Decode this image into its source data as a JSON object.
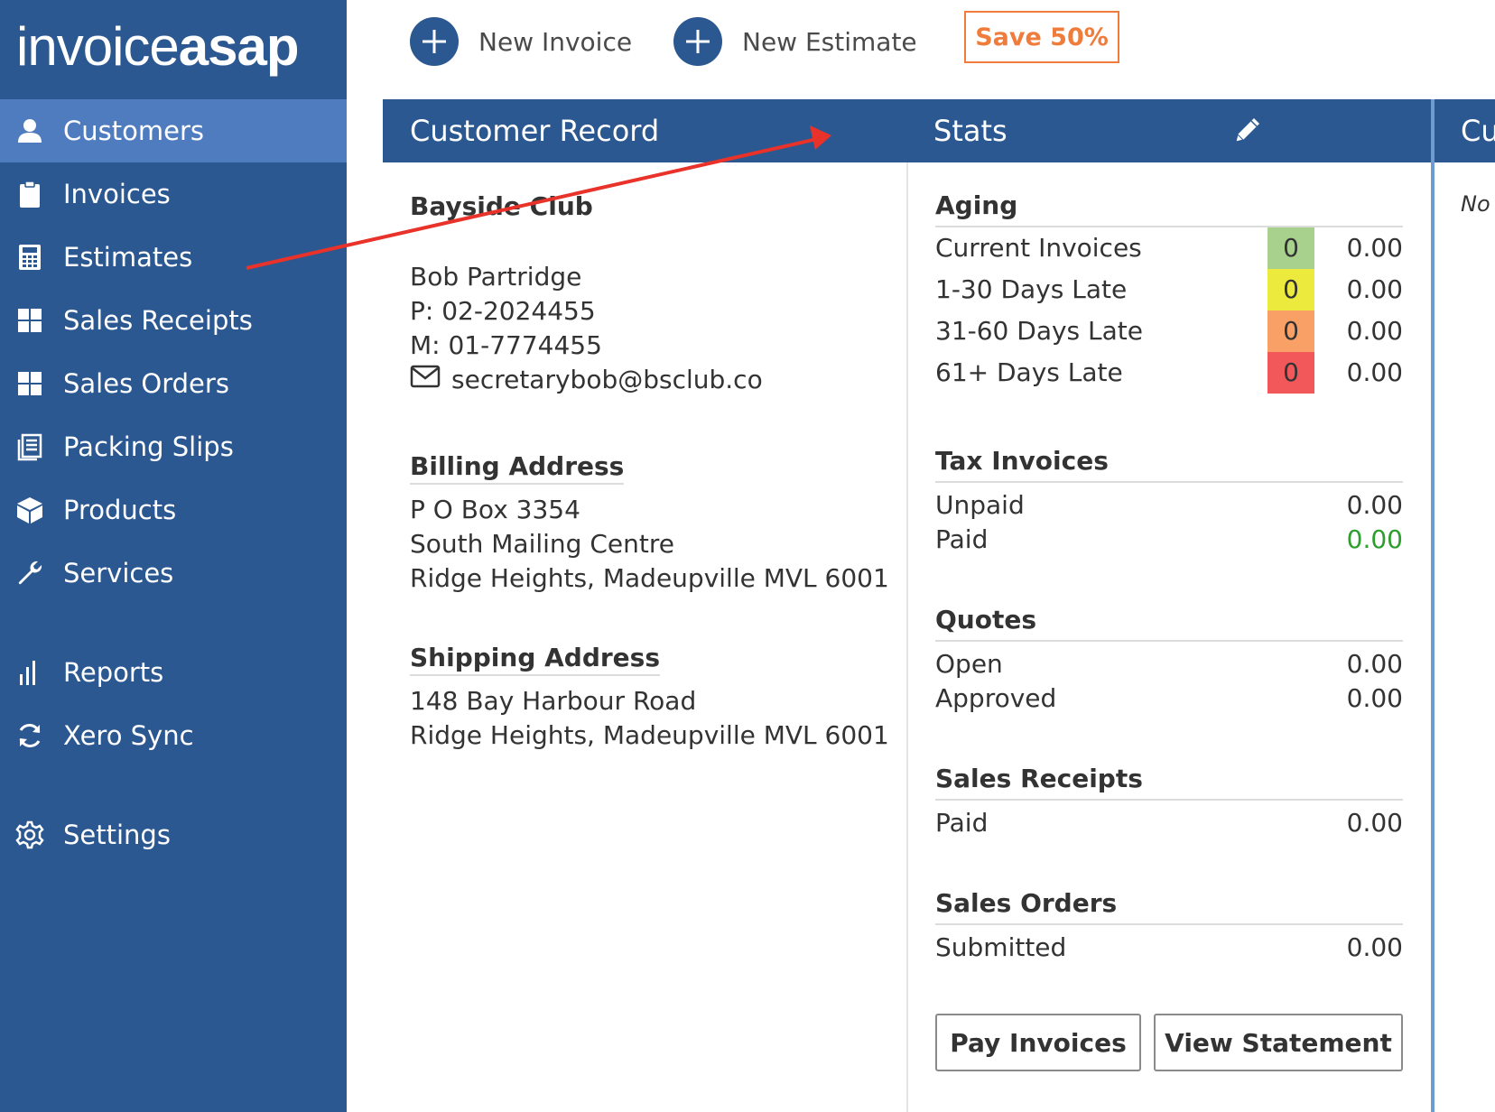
{
  "app": {
    "logo_light": "invoice",
    "logo_bold": "asap"
  },
  "sidebar": {
    "items": [
      {
        "label": "Customers",
        "icon": "user-icon"
      },
      {
        "label": "Invoices",
        "icon": "clipboard-icon"
      },
      {
        "label": "Estimates",
        "icon": "calculator-icon"
      },
      {
        "label": "Sales Receipts",
        "icon": "grid-icon"
      },
      {
        "label": "Sales Orders",
        "icon": "grid-icon"
      },
      {
        "label": "Packing Slips",
        "icon": "packing-icon"
      },
      {
        "label": "Products",
        "icon": "box-icon"
      },
      {
        "label": "Services",
        "icon": "wrench-icon"
      },
      {
        "label": "Reports",
        "icon": "bar-chart-icon"
      },
      {
        "label": "Xero Sync",
        "icon": "sync-icon"
      },
      {
        "label": "Settings",
        "icon": "gear-icon"
      }
    ]
  },
  "toolbar": {
    "new_invoice": "New Invoice",
    "new_estimate": "New Estimate",
    "promo": "Save 50%"
  },
  "panels": {
    "customer_record": "Customer Record",
    "stats": "Stats",
    "third_partial": "Cu",
    "third_partial_body": "No"
  },
  "customer": {
    "name": "Bayside Club",
    "contact": "Bob Partridge",
    "phone": "P: 02-2024455",
    "mobile": "M: 01-7774455",
    "email": "secretarybob@bsclub.co",
    "billing_heading": "Billing Address",
    "billing": [
      "P O Box 3354",
      "South Mailing Centre",
      "Ridge Heights, Madeupville MVL 6001"
    ],
    "shipping_heading": "Shipping Address",
    "shipping": [
      "148 Bay Harbour Road",
      "Ridge Heights, Madeupville MVL 6001"
    ]
  },
  "stats": {
    "aging": {
      "heading": "Aging",
      "rows": [
        {
          "label": "Current Invoices",
          "count": "0",
          "value": "0.00",
          "color": "#a9d18e"
        },
        {
          "label": "1-30 Days Late",
          "count": "0",
          "value": "0.00",
          "color": "#ecea3c"
        },
        {
          "label": "31-60 Days Late",
          "count": "0",
          "value": "0.00",
          "color": "#f9a066"
        },
        {
          "label": "61+ Days Late",
          "count": "0",
          "value": "0.00",
          "color": "#f2575a"
        }
      ]
    },
    "tax_invoices": {
      "heading": "Tax Invoices",
      "rows": [
        {
          "label": "Unpaid",
          "value": "0.00"
        },
        {
          "label": "Paid",
          "value": "0.00"
        }
      ]
    },
    "quotes": {
      "heading": "Quotes",
      "rows": [
        {
          "label": "Open",
          "value": "0.00"
        },
        {
          "label": "Approved",
          "value": "0.00"
        }
      ]
    },
    "sales_receipts": {
      "heading": "Sales Receipts",
      "rows": [
        {
          "label": "Paid",
          "value": "0.00"
        }
      ]
    },
    "sales_orders": {
      "heading": "Sales Orders",
      "rows": [
        {
          "label": "Submitted",
          "value": "0.00"
        }
      ]
    }
  },
  "buttons": {
    "pay_invoices": "Pay Invoices",
    "view_statement": "View Statement"
  },
  "colors": {
    "sidebar_bg": "#2b5891",
    "sidebar_active": "#4e7cbf",
    "promo": "#f07c3c",
    "paid_green": "#2e9e2e",
    "annotation_arrow": "#e8322a"
  }
}
